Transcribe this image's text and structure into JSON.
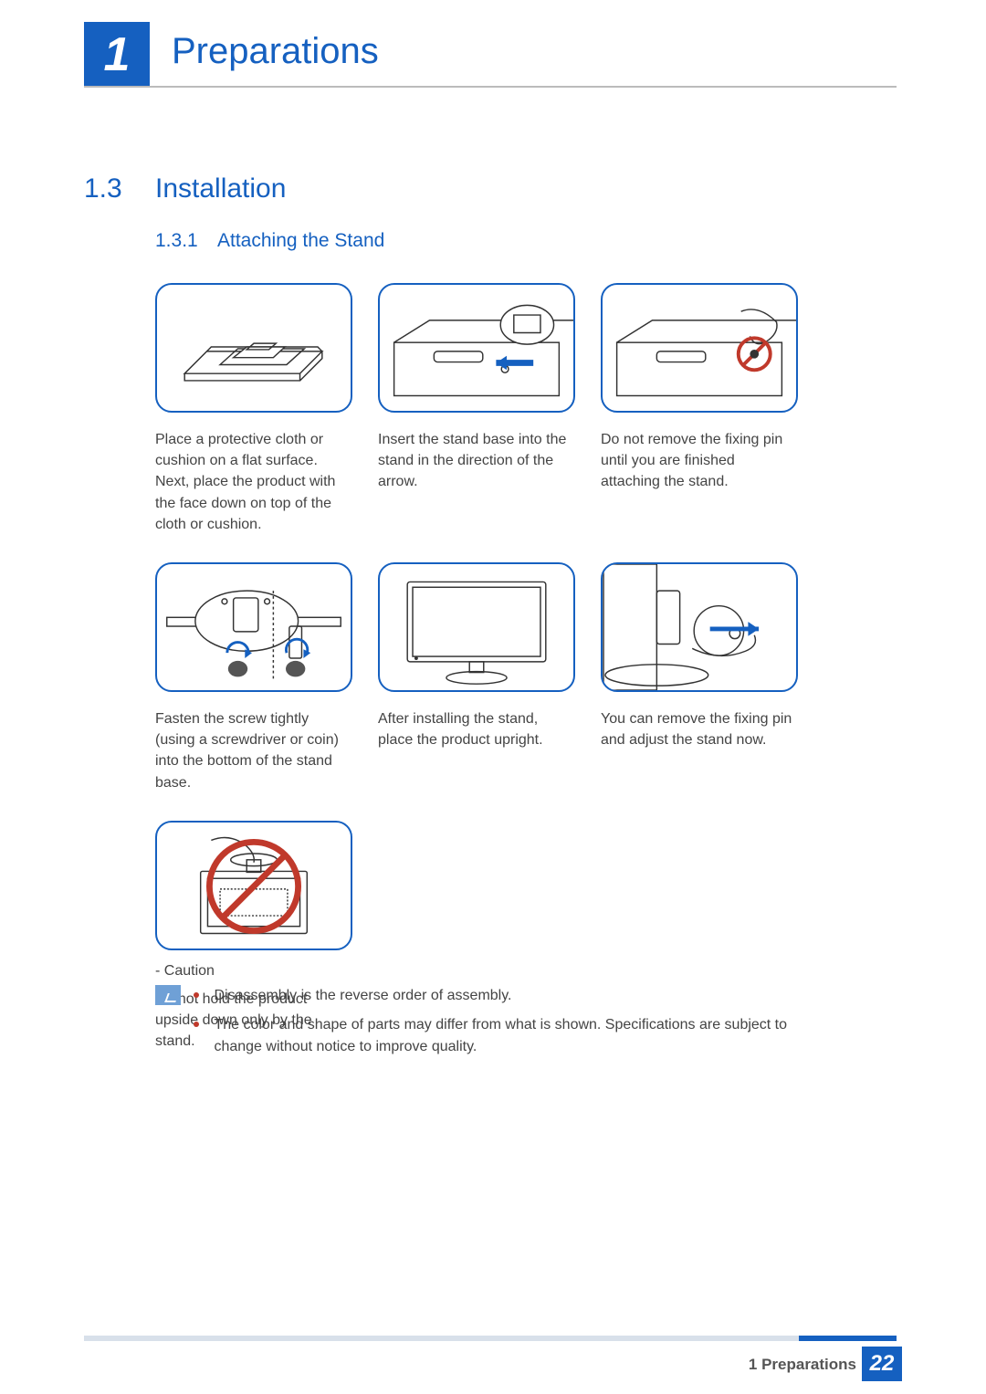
{
  "header": {
    "chapter_number": "1",
    "chapter_title": "Preparations"
  },
  "section": {
    "number": "1.3",
    "title": "Installation"
  },
  "subsection": {
    "number": "1.3.1",
    "title": "Attaching the Stand"
  },
  "steps": [
    {
      "caption": "Place a protective cloth or cushion on a flat surface. Next, place the product with the face down on top of the cloth or cushion."
    },
    {
      "caption": "Insert the stand base into the stand in the direction of the arrow."
    },
    {
      "caption": "Do not remove the fixing pin until you are finished attaching the stand."
    },
    {
      "caption": "Fasten the screw tightly (using a screwdriver or coin) into the bottom of the stand base."
    },
    {
      "caption": "After installing the stand, place the product upright."
    },
    {
      "caption": "You can remove the fixing pin and adjust the stand now."
    }
  ],
  "caution": {
    "label": "- Caution",
    "text": "Do not hold the product upside down only by the stand."
  },
  "notes": [
    "Disassembly is the reverse order of assembly.",
    "The color and shape of parts may differ from what is shown. Specifications are subject to change without notice to improve quality."
  ],
  "footer": {
    "text": "1 Preparations",
    "page": "22"
  }
}
